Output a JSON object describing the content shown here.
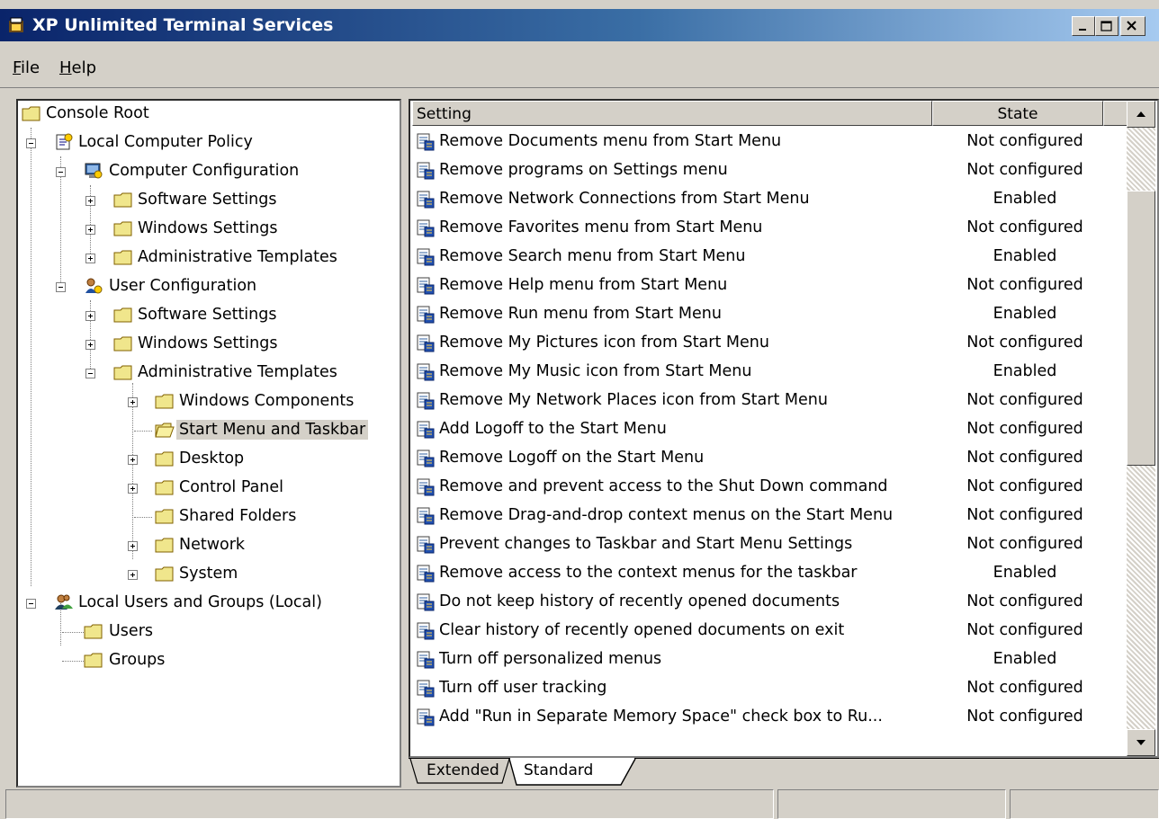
{
  "window": {
    "title": "XP Unlimited Terminal Services",
    "controls": [
      "minimize-icon",
      "maximize-icon",
      "close-icon"
    ]
  },
  "menu": {
    "file_u": "F",
    "file_rest": "ile",
    "help_u": "H",
    "help_rest": "elp"
  },
  "tree": {
    "console_root": "Console Root",
    "local_policy": "Local Computer Policy",
    "computer_config": "Computer Configuration",
    "cc_software": "Software Settings",
    "cc_windows": "Windows Settings",
    "cc_admin": "Administrative Templates",
    "user_config": "User Configuration",
    "uc_software": "Software Settings",
    "uc_windows": "Windows Settings",
    "uc_admin": "Administrative Templates",
    "windows_components": "Windows Components",
    "start_menu_taskbar": "Start Menu and Taskbar",
    "desktop": "Desktop",
    "control_panel": "Control Panel",
    "shared_folders": "Shared Folders",
    "network": "Network",
    "system": "System",
    "local_users": "Local Users and Groups (Local)",
    "users": "Users",
    "groups": "Groups",
    "selected": "Start Menu and Taskbar"
  },
  "list": {
    "col_setting": "Setting",
    "col_state": "State",
    "rows": [
      {
        "setting": "Remove Documents menu from Start Menu",
        "state": "Not configured"
      },
      {
        "setting": "Remove programs on Settings menu",
        "state": "Not configured"
      },
      {
        "setting": "Remove Network Connections from Start Menu",
        "state": "Enabled"
      },
      {
        "setting": "Remove Favorites menu from Start Menu",
        "state": "Not configured"
      },
      {
        "setting": "Remove Search menu from Start Menu",
        "state": "Enabled"
      },
      {
        "setting": "Remove Help menu from Start Menu",
        "state": "Not configured"
      },
      {
        "setting": "Remove Run menu from Start Menu",
        "state": "Enabled"
      },
      {
        "setting": "Remove My Pictures icon from Start Menu",
        "state": "Not configured"
      },
      {
        "setting": "Remove My Music icon from Start Menu",
        "state": "Enabled"
      },
      {
        "setting": "Remove My Network Places icon from Start Menu",
        "state": "Not configured"
      },
      {
        "setting": "Add Logoff to the Start Menu",
        "state": "Not configured"
      },
      {
        "setting": "Remove Logoff on the Start Menu",
        "state": "Not configured"
      },
      {
        "setting": "Remove and prevent access to the Shut Down command",
        "state": "Not configured"
      },
      {
        "setting": "Remove Drag-and-drop context menus on the Start Menu",
        "state": "Not configured"
      },
      {
        "setting": "Prevent changes to Taskbar and Start Menu Settings",
        "state": "Not configured"
      },
      {
        "setting": "Remove access to the context menus for the taskbar",
        "state": "Enabled"
      },
      {
        "setting": "Do not keep history of recently opened documents",
        "state": "Not configured"
      },
      {
        "setting": "Clear history of recently opened documents on exit",
        "state": "Not configured"
      },
      {
        "setting": "Turn off personalized menus",
        "state": "Enabled"
      },
      {
        "setting": "Turn off user tracking",
        "state": "Not configured"
      },
      {
        "setting": "Add \"Run in Separate Memory Space\" check box to Ru...",
        "state": "Not configured"
      }
    ]
  },
  "tabs": {
    "extended": "Extended",
    "standard": "Standard",
    "active": "Standard"
  },
  "colors": {
    "title_start": "#0a246a",
    "title_end": "#a6caf0",
    "face": "#d4d0c8",
    "folder": "#f0e68c"
  }
}
